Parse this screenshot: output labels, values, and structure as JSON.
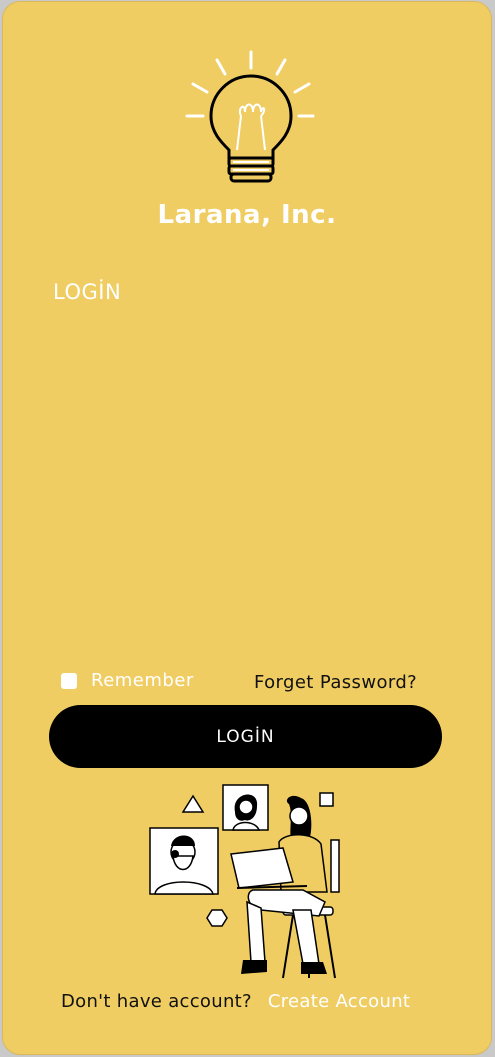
{
  "brand": {
    "name": "Larana, Inc.",
    "logo_icon": "lightbulb-icon"
  },
  "login": {
    "section_title": "LOGİN",
    "remember_label": "Remember",
    "remember_checked": false,
    "forgot_label": "Forget Password?",
    "submit_label": "LOGİN"
  },
  "illustration": {
    "icon": "remote-work-illustration"
  },
  "footer": {
    "question": "Don't have account?",
    "create_label": "Create Account"
  },
  "colors": {
    "background": "#f0cd63",
    "button": "#000000",
    "text_light": "#ffffff",
    "text_dark": "#111111"
  }
}
